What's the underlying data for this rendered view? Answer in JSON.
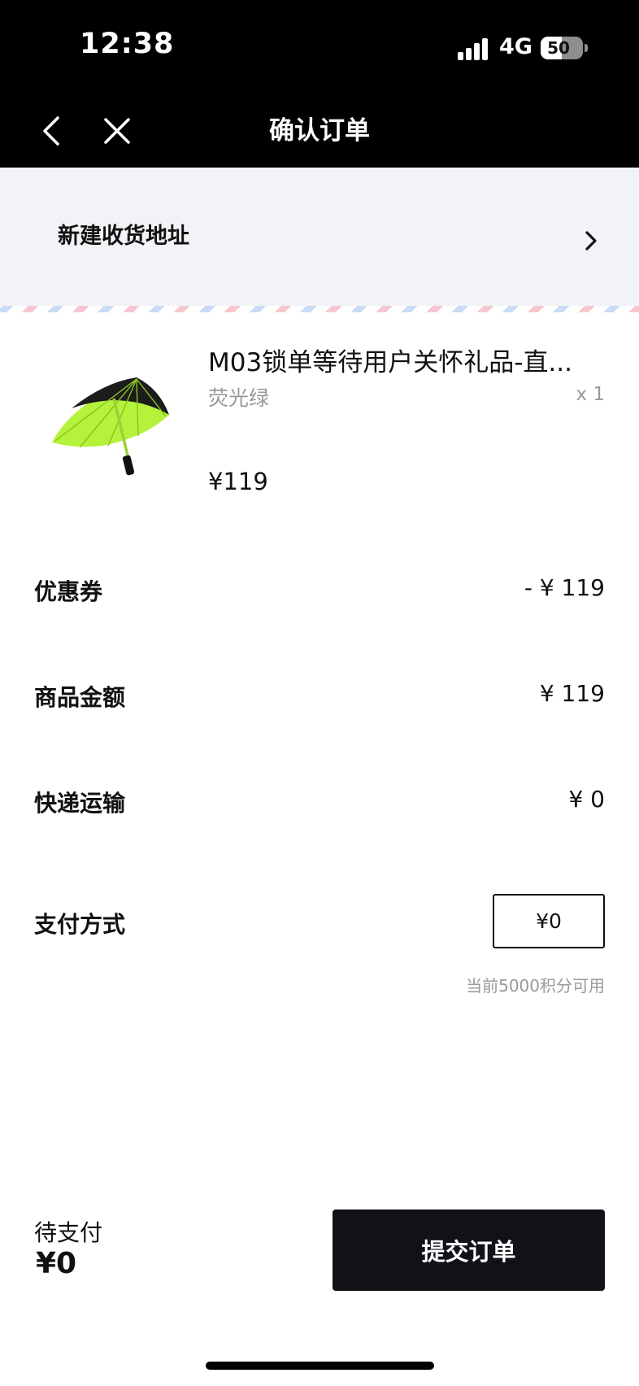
{
  "status_bar": {
    "time": "12:38",
    "network": "4G",
    "battery": "50"
  },
  "nav": {
    "back_icon": "chevron-left-icon",
    "close_icon": "close-icon",
    "title": "确认订单"
  },
  "address": {
    "label": "新建收货地址",
    "icon": "chevron-right-icon"
  },
  "product": {
    "image": "umbrella-product-image",
    "title": "M03锁单等待用户关怀礼品-直...",
    "variant": "荧光绿",
    "quantity": "x 1",
    "price": "¥119"
  },
  "summary": {
    "coupon_label": "优惠券",
    "coupon_value": "- ¥ 119",
    "goods_label": "商品金额",
    "goods_value": "¥  119",
    "shipping_label": "快递运输",
    "shipping_value": "¥ 0",
    "payment_label": "支付方式",
    "payment_value": "¥0",
    "points_note": "当前5000积分可用"
  },
  "footer": {
    "pending_label": "待支付",
    "pending_amount": "¥0",
    "submit_label": "提交订单"
  },
  "colors": {
    "header_bg": "#000000",
    "address_bg": "#f2f3f7",
    "submit_bg": "#111218",
    "muted_text": "#999999",
    "umbrella_green": "#b5f23c"
  }
}
